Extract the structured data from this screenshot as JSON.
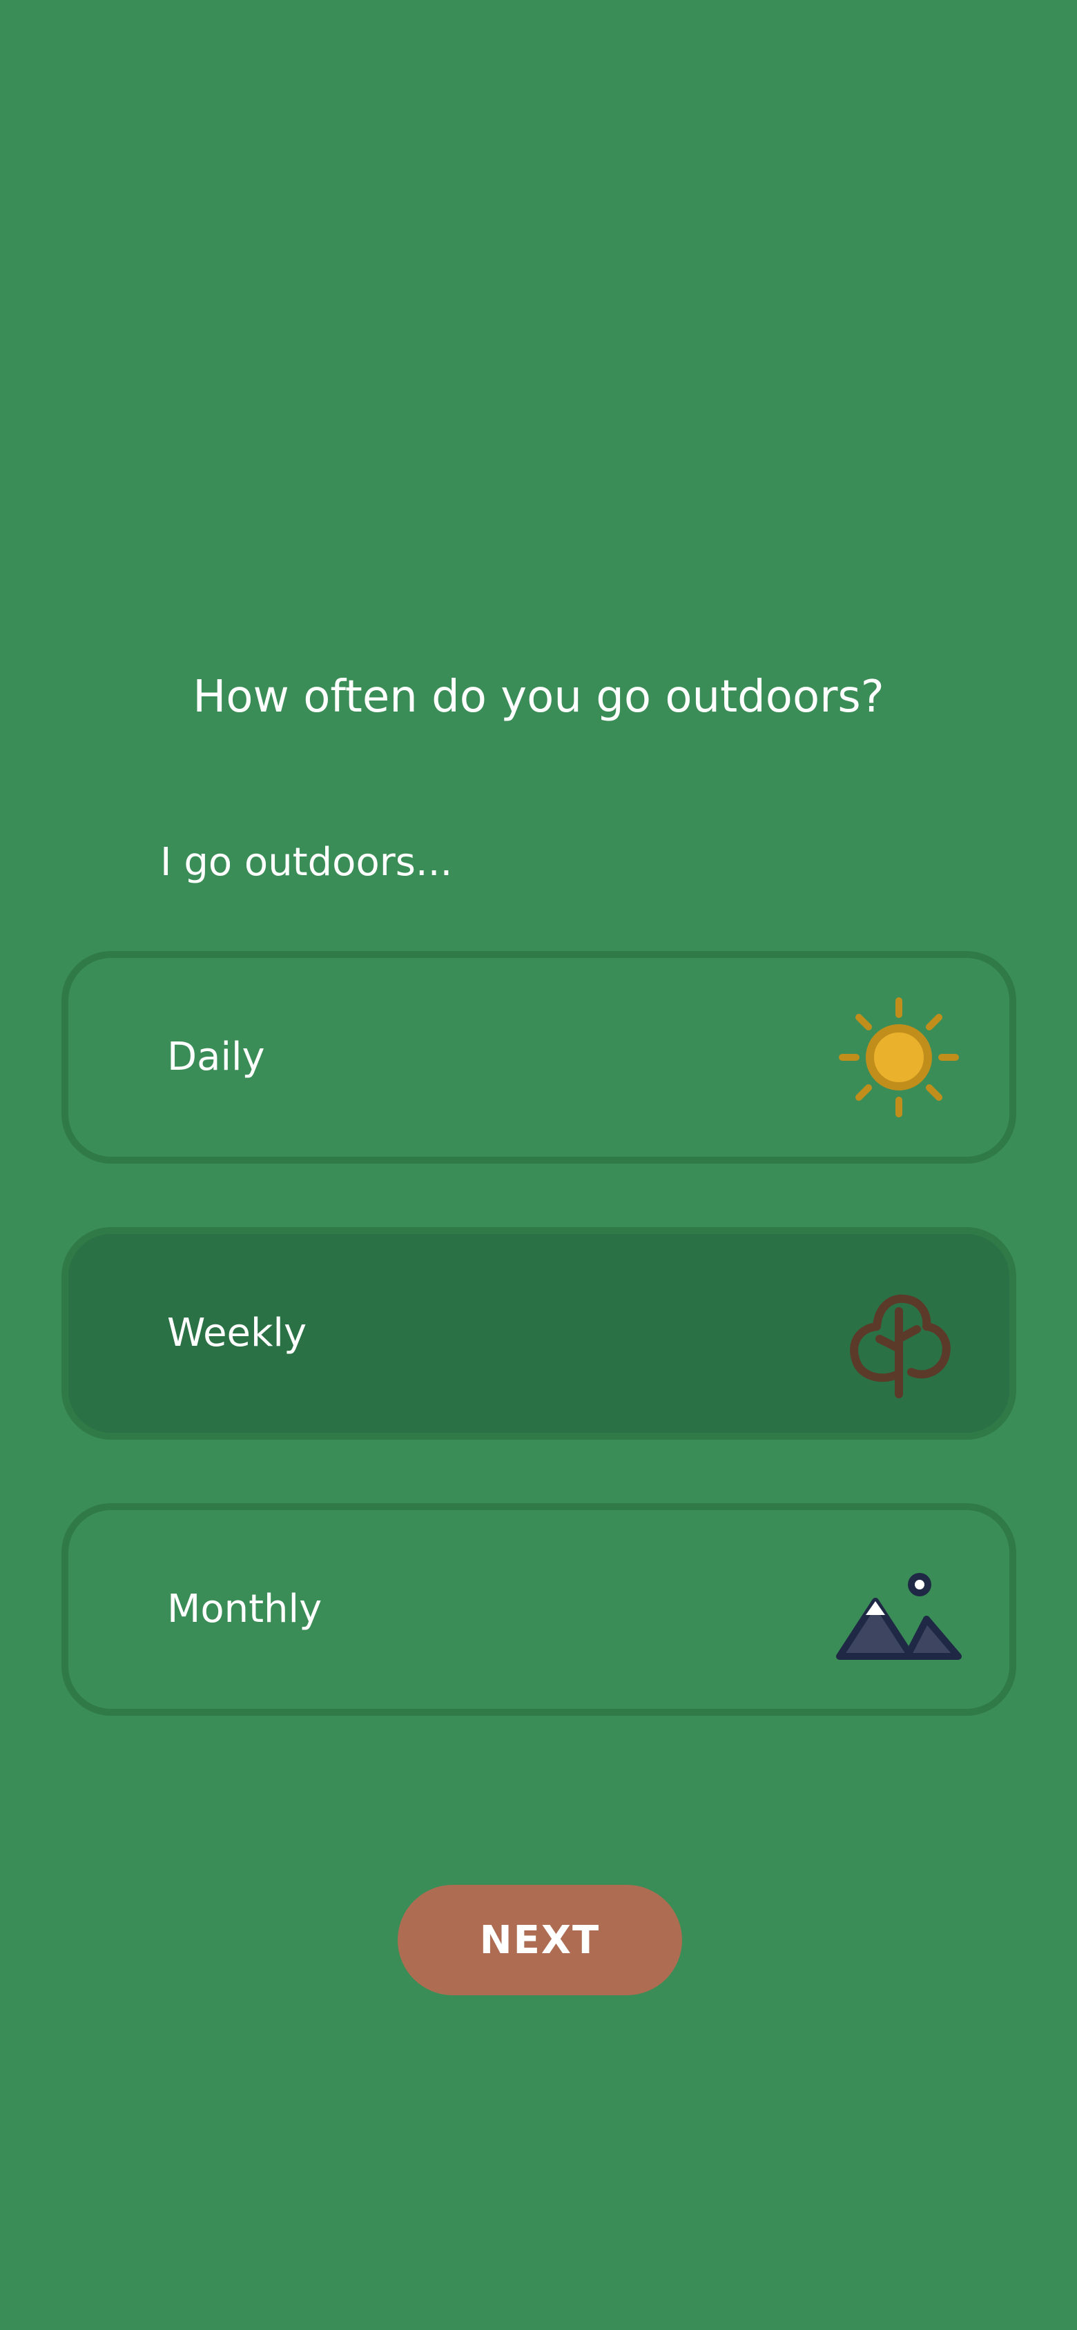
{
  "colors": {
    "background": "#3b8d57",
    "option_border": "#2f7a47",
    "option_selected_bg": "#2b7146",
    "button_bg": "#ae6d52",
    "sun": "#e9b12c",
    "sun_ring": "#c18e1b",
    "tree": "#5b3a2a",
    "mountain": "#3d4560",
    "mountain_outline": "#1f2945"
  },
  "question": "How often do you go outdoors?",
  "prompt": "I go outdoors...",
  "options": [
    {
      "label": "Daily",
      "icon": "sun-icon",
      "selected": false
    },
    {
      "label": "Weekly",
      "icon": "tree-icon",
      "selected": true
    },
    {
      "label": "Monthly",
      "icon": "mountain-icon",
      "selected": false
    }
  ],
  "next_button": {
    "label": "NEXT"
  }
}
